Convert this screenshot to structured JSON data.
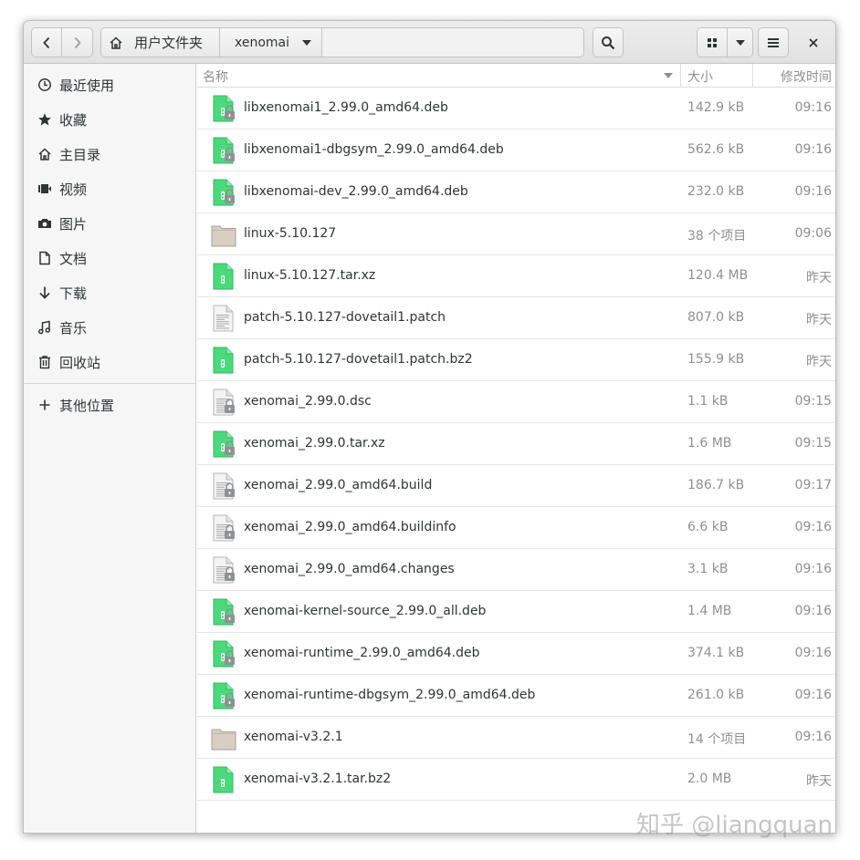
{
  "header": {
    "path_home_label": "用户文件夹",
    "path_current_label": "xenomai"
  },
  "sidebar": {
    "items": [
      {
        "label": "最近使用",
        "icon": "clock-icon"
      },
      {
        "label": "收藏",
        "icon": "star-icon"
      },
      {
        "label": "主目录",
        "icon": "home-icon"
      },
      {
        "label": "视频",
        "icon": "video-icon"
      },
      {
        "label": "图片",
        "icon": "camera-icon"
      },
      {
        "label": "文档",
        "icon": "document-icon"
      },
      {
        "label": "下载",
        "icon": "download-icon"
      },
      {
        "label": "音乐",
        "icon": "music-icon"
      },
      {
        "label": "回收站",
        "icon": "trash-icon"
      }
    ],
    "other_locations_label": "其他位置"
  },
  "columns": {
    "name": "名称",
    "size": "大小",
    "modified": "修改时间"
  },
  "files": [
    {
      "name": "libxenomai1_2.99.0_amd64.deb",
      "size": "142.9 kB",
      "modified": "09:16",
      "type": "archive-locked"
    },
    {
      "name": "libxenomai1-dbgsym_2.99.0_amd64.deb",
      "size": "562.6 kB",
      "modified": "09:16",
      "type": "archive-locked"
    },
    {
      "name": "libxenomai-dev_2.99.0_amd64.deb",
      "size": "232.0 kB",
      "modified": "09:16",
      "type": "archive-locked"
    },
    {
      "name": "linux-5.10.127",
      "size": "38 个项目",
      "modified": "09:06",
      "type": "folder"
    },
    {
      "name": "linux-5.10.127.tar.xz",
      "size": "120.4 MB",
      "modified": "昨天",
      "type": "archive"
    },
    {
      "name": "patch-5.10.127-dovetail1.patch",
      "size": "807.0 kB",
      "modified": "昨天",
      "type": "text"
    },
    {
      "name": "patch-5.10.127-dovetail1.patch.bz2",
      "size": "155.9 kB",
      "modified": "昨天",
      "type": "archive"
    },
    {
      "name": "xenomai_2.99.0.dsc",
      "size": "1.1 kB",
      "modified": "09:15",
      "type": "text-locked"
    },
    {
      "name": "xenomai_2.99.0.tar.xz",
      "size": "1.6 MB",
      "modified": "09:15",
      "type": "archive-locked"
    },
    {
      "name": "xenomai_2.99.0_amd64.build",
      "size": "186.7 kB",
      "modified": "09:17",
      "type": "text-locked"
    },
    {
      "name": "xenomai_2.99.0_amd64.buildinfo",
      "size": "6.6 kB",
      "modified": "09:16",
      "type": "text-locked"
    },
    {
      "name": "xenomai_2.99.0_amd64.changes",
      "size": "3.1 kB",
      "modified": "09:16",
      "type": "text-locked"
    },
    {
      "name": "xenomai-kernel-source_2.99.0_all.deb",
      "size": "1.4 MB",
      "modified": "09:16",
      "type": "archive-locked"
    },
    {
      "name": "xenomai-runtime_2.99.0_amd64.deb",
      "size": "374.1 kB",
      "modified": "09:16",
      "type": "archive-locked"
    },
    {
      "name": "xenomai-runtime-dbgsym_2.99.0_amd64.deb",
      "size": "261.0 kB",
      "modified": "09:16",
      "type": "archive-locked"
    },
    {
      "name": "xenomai-v3.2.1",
      "size": "14 个项目",
      "modified": "09:16",
      "type": "folder"
    },
    {
      "name": "xenomai-v3.2.1.tar.bz2",
      "size": "2.0 MB",
      "modified": "昨天",
      "type": "archive"
    }
  ],
  "watermark": "知乎 @liangquan",
  "colors": {
    "archive_green": "#4cd97b",
    "folder_tan": "#d8cfc2",
    "header_bg": "#e8e8e8",
    "sidebar_bg": "#f6f6f6"
  }
}
